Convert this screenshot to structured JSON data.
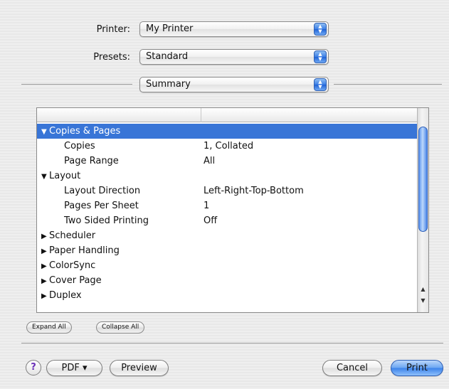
{
  "printer": {
    "label": "Printer:",
    "value": "My Printer"
  },
  "presets": {
    "label": "Presets:",
    "value": "Standard"
  },
  "panel_select": {
    "value": "Summary"
  },
  "summary": {
    "rows": [
      {
        "key": "Copies & Pages",
        "value": "",
        "level": 0,
        "expanded": true,
        "selected": true
      },
      {
        "key": "Copies",
        "value": "1, Collated",
        "level": 1
      },
      {
        "key": "Page Range",
        "value": "All",
        "level": 1
      },
      {
        "key": "Layout",
        "value": "",
        "level": 0,
        "expanded": true
      },
      {
        "key": "Layout Direction",
        "value": "Left-Right-Top-Bottom",
        "level": 1
      },
      {
        "key": "Pages Per Sheet",
        "value": "1",
        "level": 1
      },
      {
        "key": "Two Sided Printing",
        "value": "Off",
        "level": 1
      },
      {
        "key": "Scheduler",
        "value": "",
        "level": 0,
        "expanded": false
      },
      {
        "key": "Paper Handling",
        "value": "",
        "level": 0,
        "expanded": false
      },
      {
        "key": "ColorSync",
        "value": "",
        "level": 0,
        "expanded": false
      },
      {
        "key": "Cover Page",
        "value": "",
        "level": 0,
        "expanded": false
      },
      {
        "key": "Duplex",
        "value": "",
        "level": 0,
        "expanded": false
      }
    ]
  },
  "buttons": {
    "expand_all": "Expand All",
    "collapse_all": "Collapse All",
    "help": "?",
    "pdf": "PDF ▾",
    "preview": "Preview",
    "cancel": "Cancel",
    "print": "Print"
  },
  "colors": {
    "selection": "#3875d7",
    "default_button": "#3b82ea"
  },
  "icons": {
    "popup_arrows": "updown-chevrons-icon",
    "expanded": "triangle-down-icon",
    "collapsed": "triangle-right-icon"
  }
}
